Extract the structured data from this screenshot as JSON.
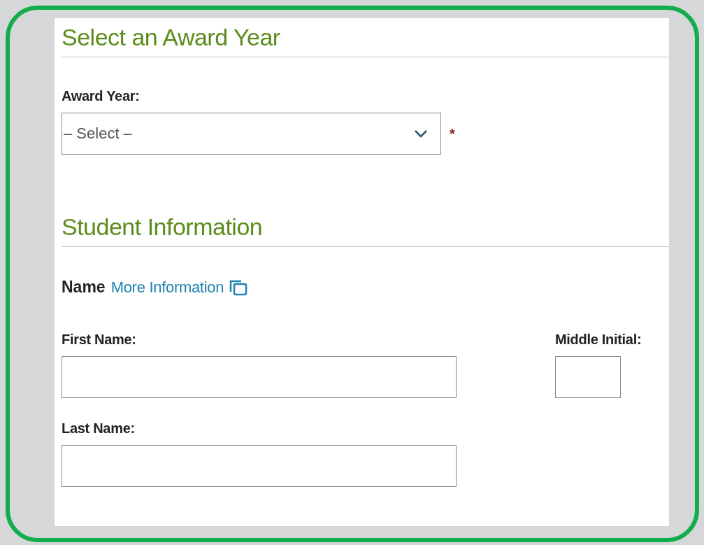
{
  "award_section": {
    "heading": "Select an Award Year",
    "field": {
      "label": "Award Year:",
      "value": "– Select –",
      "required_mark": "*"
    }
  },
  "student_section": {
    "heading": "Student Information",
    "name_label": "Name",
    "info_link": "More Information",
    "first_name": {
      "label": "First Name:"
    },
    "middle_initial": {
      "label": "Middle Initial:"
    },
    "last_name": {
      "label": "Last Name:"
    }
  }
}
